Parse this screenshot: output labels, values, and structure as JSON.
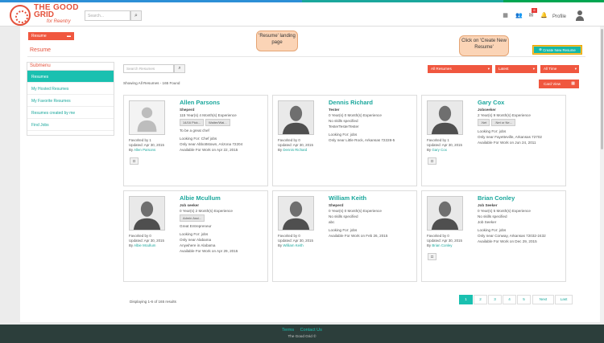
{
  "colors": {
    "accent": "#1ac0b0",
    "brand": "#f0573f",
    "callout": "#fbd4b6",
    "topbar": [
      "#2c8fd6",
      "#2c8fd6",
      "#2c8fd6",
      "#1aa79c",
      "#1aa79c",
      "#00a651"
    ]
  },
  "logo": {
    "line1": "THE GOOD",
    "line2": "GRID",
    "line3": "for Reentry"
  },
  "header": {
    "search_placeholder": "Search...",
    "notification_count": "6",
    "profile_label": "Profile",
    "icons": [
      "grid-icon",
      "users-icon",
      "mail-icon",
      "bell-icon"
    ]
  },
  "resume_tab": "Resume",
  "page_title": "Resume",
  "callouts": {
    "landing": "'Resume' landing page",
    "create": "Click on 'Create New Resume'"
  },
  "create_button": "Create New Resume",
  "submenu": {
    "title": "Submenu",
    "items": [
      "Resumes",
      "My Hosted Resumes",
      "My Favorite Resumes",
      "Resumes created by me",
      "Find Jobs"
    ]
  },
  "list": {
    "search_placeholder": "Search Resumes",
    "filters": [
      "All Resumes",
      "Latest",
      "All Time"
    ],
    "showing": "Showing All Resumes - 165 Found",
    "card_view": "Card View",
    "displaying": "Displaying 1-6 of 165 results"
  },
  "cards": [
    {
      "name": "Allen Parsons",
      "role": "Sheperd",
      "experience": "115 Year(s) 4 Month(s) Experience",
      "skills": [
        "14/16 Pick...",
        "Waiter/Wai..."
      ],
      "lines": [
        "To be a great chef"
      ],
      "looking_for": "Looking For: Chef jobs",
      "only_near": "Only near Abbottstown, Arizona 72204",
      "available": "Available For Work on Apr 22, 2015",
      "favorited": "Favorited by 1",
      "updated": "Updated: Apr 30, 2015",
      "by": "Allen Parsons",
      "by_prefix": "By",
      "photo": "placeholder",
      "camera": true
    },
    {
      "name": "Dennis Richard",
      "role": "Tester",
      "experience": "0 Year(s) 0 Month(s) Experience",
      "skills": [],
      "lines": [
        "No skills specified",
        "TesterTesterTester"
      ],
      "looking_for": "Looking For: jobs",
      "only_near": "Only near Little Rock, Arkansas 72228-5",
      "available": "",
      "favorited": "Favorited by 0",
      "updated": "Updated: Apr 30, 2015",
      "by": "Dennis Richard",
      "by_prefix": "By",
      "photo": "silhouette",
      "camera": false
    },
    {
      "name": "Gary Cox",
      "role": "Jobseeker",
      "experience": "2 Year(s) 9 Month(s) Experience",
      "skills": [
        ".Net",
        ".Net or Ne..."
      ],
      "lines": [],
      "looking_for": "Looking For: jobs",
      "only_near": "Only near Fayetteville, Arkansas 72702",
      "available": "Available For Work on Jun 24, 2011",
      "favorited": "Favorited by 1",
      "updated": "Updated: Apr 30, 2015",
      "by": "Gary Cox",
      "by_prefix": "By",
      "photo": "silhouette",
      "camera": true
    },
    {
      "name": "Albie Mcullum",
      "role": "Job seeker",
      "experience": "0 Year(s) 2 Month(s) Experience",
      "skills": [
        "Admin Assi..."
      ],
      "lines": [
        "Great Entrepreneur"
      ],
      "looking_for": "Looking For: jobs",
      "only_near": "Only near Alabama",
      "available": "Anywhere in Alabama",
      "available2": "Available For Work on Apr 29, 2015",
      "favorited": "Favorited by 0",
      "updated": "Updated: Apr 30, 2015",
      "by": "Albie Mcullum",
      "by_prefix": "By",
      "photo": "silhouette",
      "camera": false
    },
    {
      "name": "William Keith",
      "role": "Sheperd",
      "experience": "0 Year(s) 0 Month(s) Experience",
      "skills": [],
      "lines": [
        "No skills specified",
        "abc"
      ],
      "looking_for": "Looking For: jobs",
      "only_near": "",
      "available": "Available For Work on Feb 26, 2015",
      "favorited": "Favorited by 0",
      "updated": "Updated: Apr 30, 2015",
      "by": "William Keith",
      "by_prefix": "By",
      "photo": "silhouette",
      "camera": false
    },
    {
      "name": "Brian Conley",
      "role": "Job Seeker",
      "experience": "0 Year(s) 5 Month(s) Experience",
      "skills": [],
      "lines": [
        "No skills specified",
        "Job Seeker"
      ],
      "looking_for": "Looking For: jobs",
      "only_near": "Only near Conway, Arkansas 72032-2432",
      "available": "Available For Work on Dec 29, 2015",
      "favorited": "Favorited by 0",
      "updated": "Updated: Apr 30, 2015",
      "by": "Brian Conley",
      "by_prefix": "By",
      "photo": "silhouette",
      "camera": true
    }
  ],
  "pagination": [
    "1",
    "2",
    "3",
    "4",
    "5",
    "Next",
    "Last"
  ],
  "footer": {
    "links": [
      "Terms",
      "Contact Us"
    ],
    "copyright": "The Good Grid ©"
  }
}
